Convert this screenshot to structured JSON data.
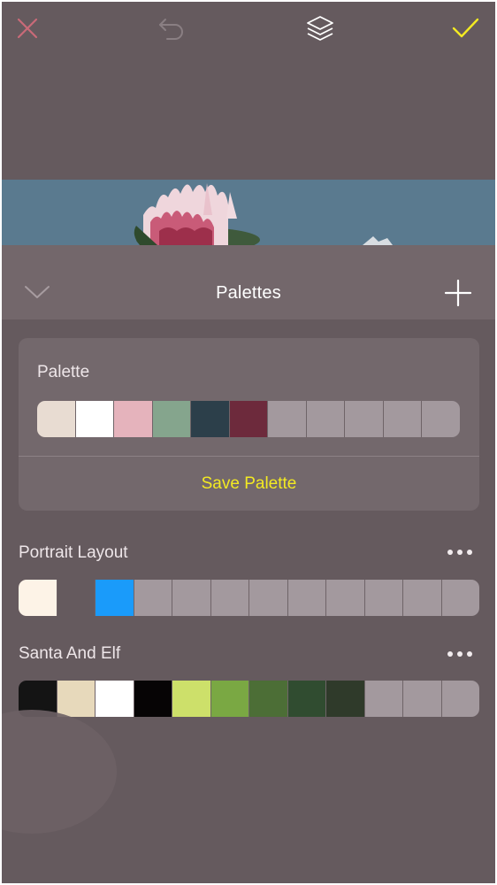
{
  "toolbar": {
    "close_icon": "close-icon",
    "undo_icon": "undo-icon",
    "layers_icon": "layers-icon",
    "confirm_icon": "check-icon",
    "close_color": "#c96a78",
    "confirm_color": "#f3ea22"
  },
  "sheet": {
    "title": "Palettes",
    "collapse_icon": "chevron-down-icon",
    "add_icon": "plus-icon"
  },
  "current_palette": {
    "label": "Palette",
    "swatches": [
      "#e8dcd2",
      "#ffffff",
      "#e5b3bc",
      "#85a58d",
      "#2c3f4a",
      "#6d2a3c",
      "#a3999e",
      "#a3999e",
      "#a3999e",
      "#a3999e",
      "#a3999e"
    ],
    "save_label": "Save Palette"
  },
  "palettes": [
    {
      "name": "Portrait Layout",
      "more_icon": "more-icon",
      "swatches": [
        "#fdf3e7",
        "#655a5e",
        "#1a9bfa",
        "#a3999e",
        "#a3999e",
        "#a3999e",
        "#a3999e",
        "#a3999e",
        "#a3999e",
        "#a3999e",
        "#a3999e",
        "#a3999e"
      ]
    },
    {
      "name": "Santa And Elf",
      "more_icon": "more-icon",
      "swatches": [
        "#141414",
        "#e7d9bb",
        "#ffffff",
        "#060405",
        "#cde06a",
        "#7aa843",
        "#4c6e36",
        "#304c30",
        "#2f3a2a",
        "#a3999e",
        "#a3999e",
        "#a3999e"
      ]
    }
  ]
}
